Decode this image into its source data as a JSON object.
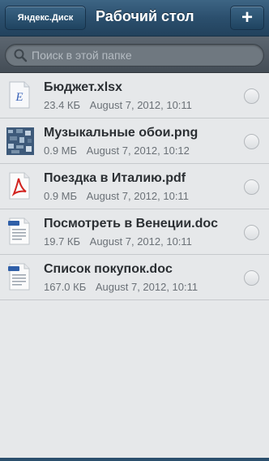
{
  "navbar": {
    "back_label": "Яндекс.Диск",
    "title": "Рабочий стол",
    "add_label": "+"
  },
  "search": {
    "placeholder": "Поиск в этой папке"
  },
  "files": [
    {
      "name": "Бюджет.xlsx",
      "size": "23.4 КБ",
      "date": "August 7, 2012, 10:11",
      "icon": "spreadsheet-icon"
    },
    {
      "name": "Музыкальные обои.png",
      "size": "0.9 МБ",
      "date": "August 7, 2012, 10:12",
      "icon": "image-thumbnail-icon"
    },
    {
      "name": "Поездка в Италию.pdf",
      "size": "0.9 МБ",
      "date": "August 7, 2012, 10:11",
      "icon": "pdf-icon"
    },
    {
      "name": "Посмотреть в Венеции.doc",
      "size": "19.7 КБ",
      "date": "August 7, 2012, 10:11",
      "icon": "doc-icon"
    },
    {
      "name": "Список покупок.doc",
      "size": "167.0 КБ",
      "date": "August 7, 2012, 10:11",
      "icon": "doc-icon"
    }
  ]
}
